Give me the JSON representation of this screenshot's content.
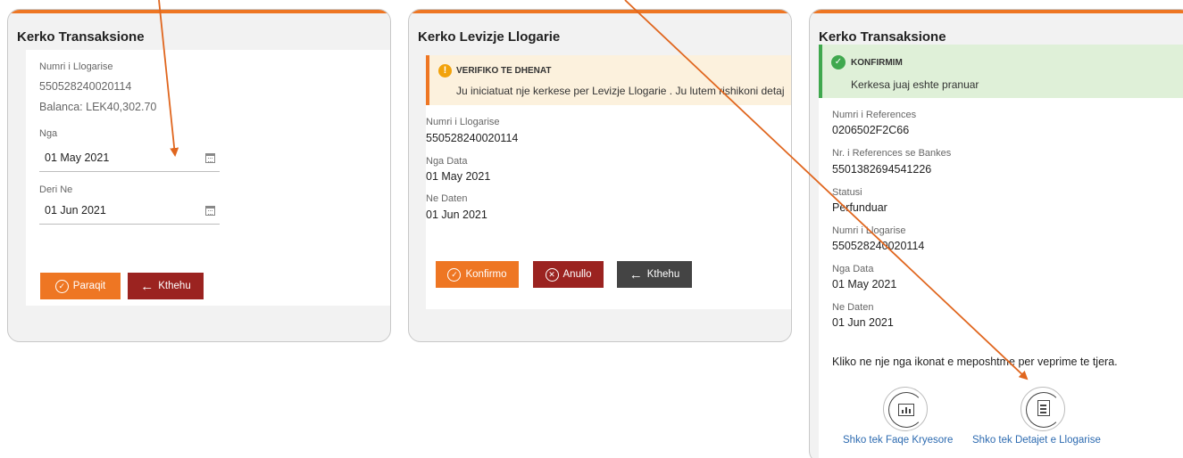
{
  "panel1": {
    "title": "Kerko Transaksione",
    "account_label": "Numri i Llogarise",
    "account_value": "550528240020114",
    "balance": "Balanca: LEK40,302.70",
    "from_label": "Nga",
    "from_value": "01 May 2021",
    "to_label": "Deri Ne",
    "to_value": "01 Jun 2021",
    "show_button": "Paraqit",
    "back_button": "Kthehu"
  },
  "panel2": {
    "title": "Kerko Levizje Llogarie",
    "alert_title": "VERIFIKO TE DHENAT",
    "alert_message": "Ju iniciatuat nje kerkese per Levizje Llogarie . Ju lutem rishikoni detaj",
    "account_label": "Numri i Llogarise",
    "account_value": "550528240020114",
    "from_label": "Nga Data",
    "from_value": "01 May 2021",
    "to_label": "Ne Daten",
    "to_value": "01 Jun 2021",
    "confirm_button": "Konfirmo",
    "cancel_button": "Anullo",
    "back_button": "Kthehu"
  },
  "panel3": {
    "title": "Kerko Transaksione",
    "alert_title": "KONFIRMIM",
    "alert_message": "Kerkesa juaj eshte pranuar",
    "fields": [
      {
        "label": "Numri i References",
        "value": "0206502F2C66"
      },
      {
        "label": "Nr. i References se Bankes",
        "value": "5501382694541226"
      },
      {
        "label": "Statusi",
        "value": "Perfunduar"
      },
      {
        "label": "Numri i Llogarise",
        "value": "550528240020114"
      },
      {
        "label": "Nga Data",
        "value": "01 May 2021"
      },
      {
        "label": "Ne Daten",
        "value": "01 Jun 2021"
      }
    ],
    "hint": "Kliko ne nje nga ikonat e meposhtme per veprime te tjera.",
    "home_link": "Shko tek Faqe Kryesore",
    "details_link": "Shko tek Detajet e Llogarise"
  },
  "icons": {
    "calendar": "calendar-icon",
    "check": "check-circle-icon",
    "cancel": "x-circle-icon",
    "back": "arrow-left-icon",
    "warning": "info-warning-icon",
    "success": "check-success-icon",
    "home": "home-dashboard-icon",
    "details": "document-details-icon"
  },
  "colors": {
    "accent": "#ee7623",
    "danger": "#9b2320",
    "neutral": "#444444",
    "success": "#3fa84e",
    "link": "#2c6ab0",
    "annotation_arrow": "#e0661e"
  }
}
